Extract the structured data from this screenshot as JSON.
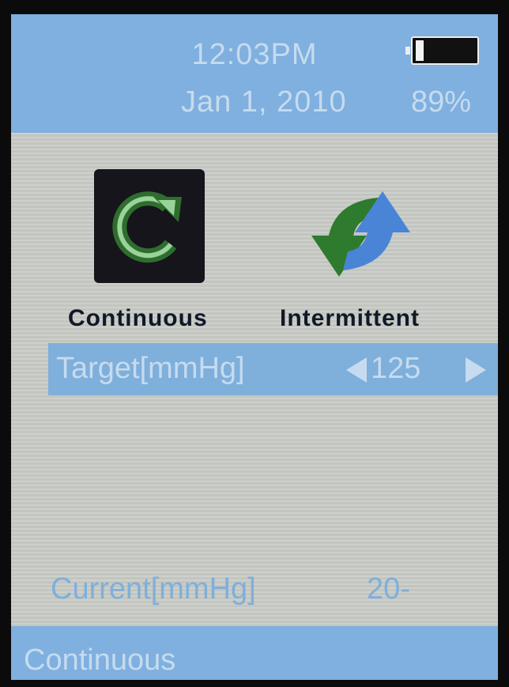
{
  "status": {
    "time": "12:03PM",
    "date": "Jan 1, 2010",
    "battery_percent": "89%",
    "battery_level": 0.89
  },
  "modes": [
    {
      "label": "Continuous",
      "icon": "refresh-circular-arrow-icon"
    },
    {
      "label": "Intermittent",
      "icon": "cycle-arrows-icon"
    }
  ],
  "target": {
    "label": "Target[mmHg]",
    "value": "125"
  },
  "current": {
    "label": "Current[mmHg]",
    "value": "20-"
  },
  "footer": {
    "mode_label": "Continuous"
  },
  "colors": {
    "header_blue": "#7fb0df",
    "light_text": "#c6dbef",
    "screen_gray": "#c9ccc7",
    "arrow_green": "#2e7a2e",
    "arrow_blue": "#4a84d6"
  }
}
